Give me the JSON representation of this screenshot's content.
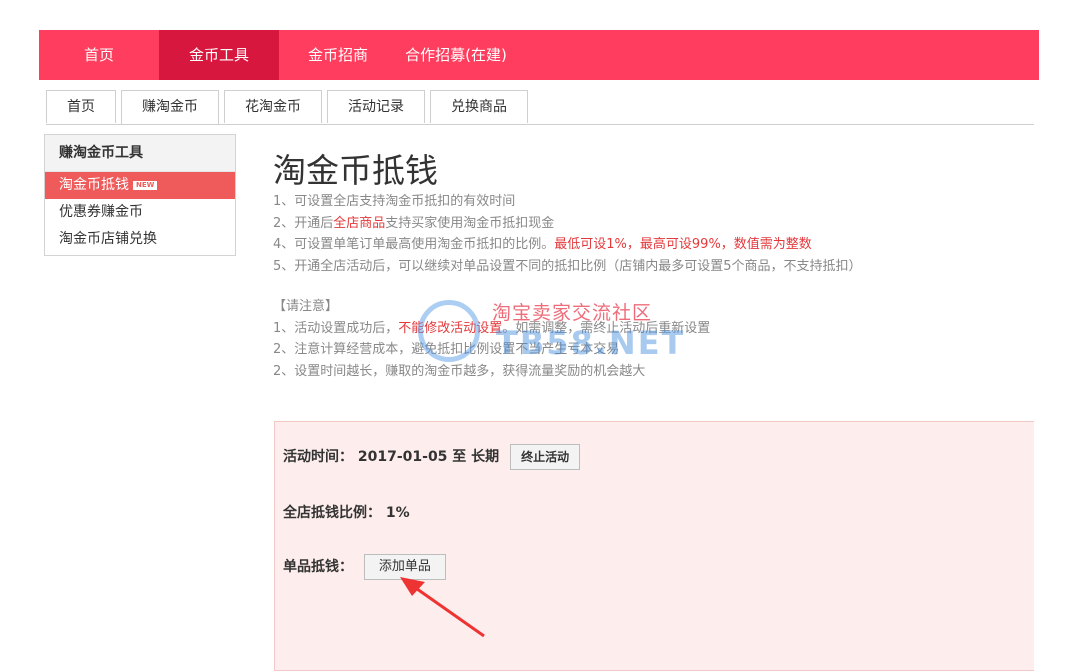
{
  "topnav": {
    "items": [
      {
        "label": "首页"
      },
      {
        "label": "金币工具",
        "active": true
      },
      {
        "label": "金币招商"
      },
      {
        "label": "合作招募(在建)"
      }
    ]
  },
  "tabs": {
    "items": [
      {
        "label": "首页"
      },
      {
        "label": "赚淘金币",
        "active": true
      },
      {
        "label": "花淘金币"
      },
      {
        "label": "活动记录"
      },
      {
        "label": "兑换商品"
      }
    ]
  },
  "sidebar": {
    "title": "赚淘金币工具",
    "items": [
      {
        "label": "淘金币抵钱",
        "badge": "NEW",
        "active": true
      },
      {
        "label": "优惠券赚金币"
      },
      {
        "label": "淘金币店铺兑换"
      }
    ]
  },
  "page": {
    "title": "淘金币抵钱",
    "rules": {
      "r1": "1、可设置全店支持淘金币抵扣的有效时间",
      "r2_a": "2、开通后",
      "r2_red": "全店商品",
      "r2_b": "支持买家使用淘金币抵扣现金",
      "r3_a": "4、可设置单笔订单最高使用淘金币抵扣的比例。",
      "r3_red": "最低可设1%，最高可设99%，数值需为整数",
      "r4": "5、开通全店活动后，可以继续对单品设置不同的抵扣比例（店铺内最多可设置5个商品，不支持抵扣）"
    },
    "notice": {
      "title": "【请注意】",
      "n1_a": "1、活动设置成功后，",
      "n1_red": "不能修改活动设置",
      "n1_b": "。如需调整，需终止活动后重新设置",
      "n2": "2、注意计算经营成本，避免抵扣比例设置不当产生亏本交易",
      "n3": "2、设置时间越长，赚取的淘金币越多，获得流量奖励的机会越大"
    }
  },
  "watermark": {
    "line1": "淘宝卖家交流社区",
    "line2": "TB58.NET"
  },
  "panel": {
    "time_label": "活动时间：",
    "time_value": "2017-01-05 至 长期",
    "stop_button": "终止活动",
    "ratio_label": "全店抵钱比例：",
    "ratio_value": "1%",
    "single_label": "单品抵钱：",
    "add_button": "添加单品"
  },
  "colors": {
    "topnav_bg": "#ff3d5e",
    "topnav_active": "#d8173e",
    "sidebar_active": "#ef5b5b",
    "highlight_red": "#e4393c",
    "panel_bg": "#fdeeed"
  }
}
